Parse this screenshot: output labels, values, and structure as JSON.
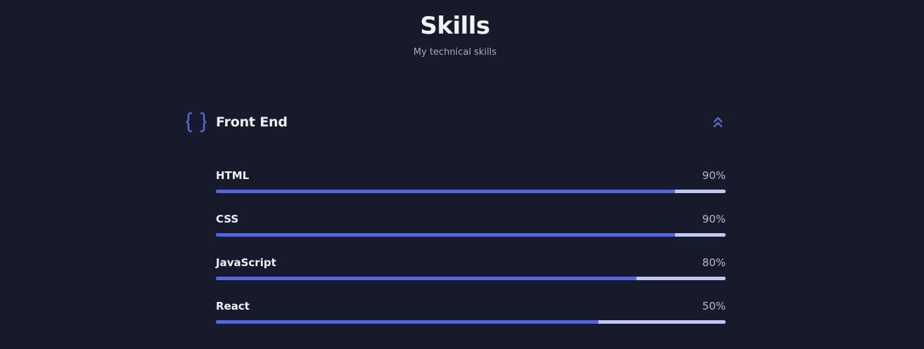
{
  "section": {
    "title": "Skills",
    "subtitle": "My technical skills"
  },
  "category": {
    "title": "Front End",
    "icon": "braces-icon",
    "toggle_icon": "chevrons-up-icon"
  },
  "skills": [
    {
      "name": "HTML",
      "percent_label": "90%",
      "fill_fraction": 0.9
    },
    {
      "name": "CSS",
      "percent_label": "90%",
      "fill_fraction": 0.9
    },
    {
      "name": "JavaScript",
      "percent_label": "80%",
      "fill_fraction": 0.825
    },
    {
      "name": "React",
      "percent_label": "50%",
      "fill_fraction": 0.75
    }
  ],
  "colors": {
    "background": "#161a2a",
    "accent": "#5667d2",
    "bar_track": "#c2c8f0",
    "text": "#eef0f7",
    "muted": "#a7abbe"
  }
}
